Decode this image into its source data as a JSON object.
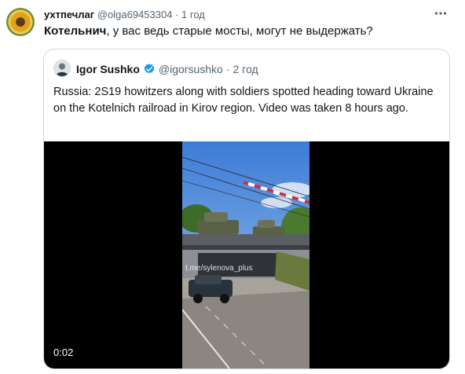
{
  "tweet": {
    "author_name": "ухтпечлаг",
    "author_handle": "@olga69453304",
    "separator": "·",
    "time": "1 год",
    "more_icon": "more-horizontal-icon",
    "text_bold": "Котельнич",
    "text_rest": ", у вас ведь старые мосты, могут не выдержать?"
  },
  "quote": {
    "author_name": "Igor Sushko",
    "author_handle": "@igorsushko",
    "separator": "·",
    "time": "2 год",
    "verified_icon": "verified-badge-icon",
    "verified_color": "#1d9bf0",
    "text": "Russia: 2S19 howitzers along with soldiers spotted heading toward Ukraine on the Kotelnich railroad in Kirov region. Video was taken 8 hours ago.",
    "video": {
      "watermark": "t.me/sylenova_plus",
      "duration": "0:02"
    }
  }
}
